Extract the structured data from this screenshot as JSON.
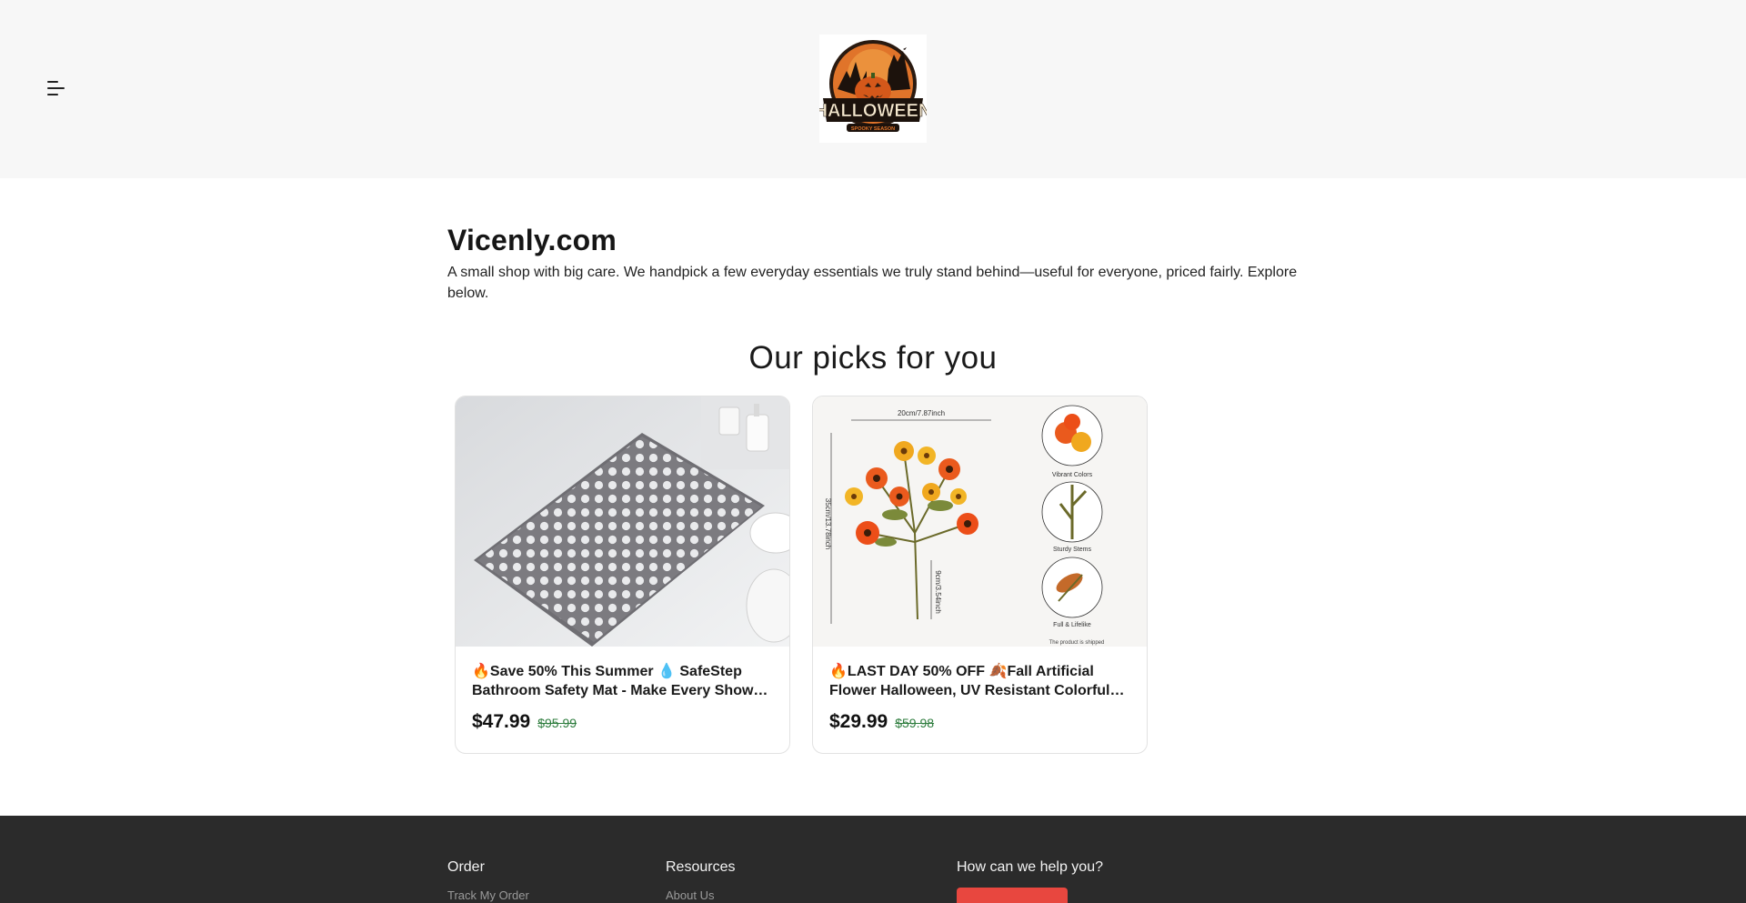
{
  "header": {
    "menu_icon": "hamburger-menu-icon",
    "logo": {
      "text": "HALLOWEEN",
      "subtext": "SPOOKY SEASON",
      "icon": "halloween-pumpkin-logo"
    }
  },
  "intro": {
    "title": "Vicenly.com",
    "description": "A small shop with big care. We handpick a few everyday essentials we truly stand behind—useful for everyone, priced fairly. Explore below."
  },
  "picks": {
    "heading": "Our picks for you",
    "products": [
      {
        "title": "🔥Save 50% This Summer 💧 SafeStep Bathroom Safety Mat - Make Every Shower Safe",
        "price": "$47.99",
        "old_price": "$95.99"
      },
      {
        "title": "🔥LAST DAY 50% OFF 🍂Fall Artificial Flower Halloween, UV Resistant Colorful Flower",
        "price": "$29.99",
        "old_price": "$59.98",
        "image_labels": {
          "width": "20cm/7.87inch",
          "height": "35cm/13.78inch",
          "stem": "9cm/3.54inch",
          "feature_1": "Vibrant Colors",
          "feature_2": "Sturdy Stems",
          "feature_3": "Full & Lifelike",
          "note": "The product is shipped"
        }
      }
    ]
  },
  "footer": {
    "order": {
      "heading": "Order",
      "links": [
        "Track My Order"
      ]
    },
    "resources": {
      "heading": "Resources",
      "links": [
        "About Us"
      ]
    },
    "help": {
      "heading": "How can we help you?"
    }
  },
  "colors": {
    "header_bg": "#f7f7f7",
    "footer_bg": "#2b2b2b",
    "accent_red": "#e8473f",
    "old_price_green": "#2e7d3e"
  }
}
